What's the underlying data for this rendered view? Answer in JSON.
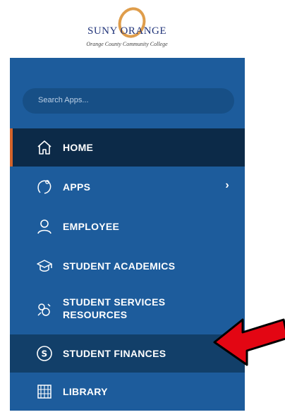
{
  "logo": {
    "word": "SUNY ORANGE",
    "subtitle": "Orange County Community College"
  },
  "search": {
    "placeholder": "Search Apps..."
  },
  "nav": {
    "items": [
      {
        "label": "HOME",
        "icon": "home-icon"
      },
      {
        "label": "APPS",
        "icon": "apps-icon",
        "chevron": "›"
      },
      {
        "label": "EMPLOYEE",
        "icon": "person-icon"
      },
      {
        "label": "STUDENT ACADEMICS",
        "icon": "graduation-cap-icon"
      },
      {
        "label": "STUDENT SERVICES\nRESOURCES",
        "icon": "services-icon"
      },
      {
        "label": "STUDENT FINANCES",
        "icon": "dollar-circle-icon"
      },
      {
        "label": "LIBRARY",
        "icon": "library-icon"
      }
    ]
  },
  "colors": {
    "panel": "#1d5c9c",
    "active": "#0c2a48",
    "accent": "#d4632a",
    "arrow": "#e30613"
  }
}
